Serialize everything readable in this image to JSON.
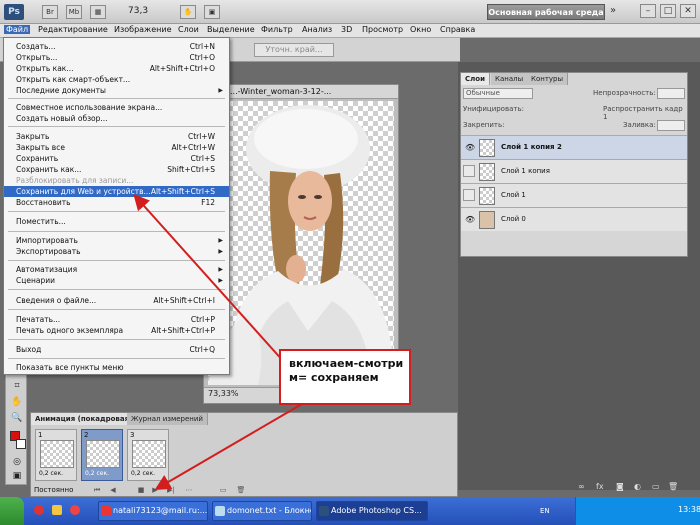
{
  "app": {
    "logo": "Ps",
    "zoom": "73,3",
    "workspace": "Основная рабочая среда",
    "more": "»"
  },
  "menubar": {
    "items": [
      "Файл",
      "Редактирование",
      "Изображение",
      "Слои",
      "Выделение",
      "Фильтр",
      "Анализ",
      "3D",
      "Просмотр",
      "Окно",
      "Справка"
    ]
  },
  "options": {
    "refine_edge": "Уточн. край..."
  },
  "file_menu": {
    "items": [
      {
        "label": "Создать...",
        "shortcut": "Ctrl+N"
      },
      {
        "label": "Открыть...",
        "shortcut": "Ctrl+O"
      },
      {
        "label": "Открыть как...",
        "shortcut": "Alt+Shift+Ctrl+O"
      },
      {
        "label": "Открыть как смарт-объект...",
        "shortcut": ""
      },
      {
        "label": "Последние документы",
        "shortcut": ""
      },
      {
        "label": "Совместное использование экрана...",
        "shortcut": ""
      },
      {
        "label": "Создать новый обзор...",
        "shortcut": ""
      },
      {
        "label": "Закрыть",
        "shortcut": "Ctrl+W"
      },
      {
        "label": "Закрыть все",
        "shortcut": "Alt+Ctrl+W"
      },
      {
        "label": "Сохранить",
        "shortcut": "Ctrl+S"
      },
      {
        "label": "Сохранить как...",
        "shortcut": "Shift+Ctrl+S"
      },
      {
        "label": "Разблокировать для записи...",
        "shortcut": ""
      },
      {
        "label": "Сохранить для Web и устройств...",
        "shortcut": "Alt+Shift+Ctrl+S"
      },
      {
        "label": "Восстановить",
        "shortcut": "F12"
      },
      {
        "label": "Поместить...",
        "shortcut": ""
      },
      {
        "label": "Импортировать",
        "shortcut": ""
      },
      {
        "label": "Экспортировать",
        "shortcut": ""
      },
      {
        "label": "Автоматизация",
        "shortcut": ""
      },
      {
        "label": "Сценарии",
        "shortcut": ""
      },
      {
        "label": "Сведения о файле...",
        "shortcut": "Alt+Shift+Ctrl+I"
      },
      {
        "label": "Печатать...",
        "shortcut": "Ctrl+P"
      },
      {
        "label": "Печать одного экземпляра",
        "shortcut": "Alt+Shift+Ctrl+P"
      },
      {
        "label": "Выход",
        "shortcut": "Ctrl+Q"
      },
      {
        "label": "Показать все пункты меню",
        "shortcut": ""
      }
    ]
  },
  "document": {
    "title": "...-Winter_woman-3-12-...",
    "zoom": "73,33%"
  },
  "layers_panel": {
    "tabs": [
      "Слои",
      "Каналы",
      "Контуры"
    ],
    "blend_mode": "Обычные",
    "opacity_label": "Непрозрачность:",
    "unify_label": "Унифицировать:",
    "propagate_label": "Распространить кадр 1",
    "lock_label": "Закрепить:",
    "fill_label": "Заливка:",
    "layers": [
      {
        "name": "Слой 1 копия 2",
        "visible": true,
        "selected": true
      },
      {
        "name": "Слой 1 копия",
        "visible": false,
        "selected": false
      },
      {
        "name": "Слой 1",
        "visible": false,
        "selected": false
      },
      {
        "name": "Слой 0",
        "visible": true,
        "selected": false
      }
    ]
  },
  "animation_panel": {
    "tabs": [
      "Анимация (покадровая)",
      "Журнал измерений"
    ],
    "frames": [
      {
        "num": "1",
        "delay": "0,2 сек."
      },
      {
        "num": "2",
        "delay": "0,2 сек."
      },
      {
        "num": "3",
        "delay": "0,2 сек."
      }
    ],
    "loop": "Постоянно"
  },
  "annotation": {
    "line1": "включаем-смотри",
    "line2": "м= сохраняем"
  },
  "taskbar": {
    "items": [
      {
        "label": "natali73123@mail.ru:..."
      },
      {
        "label": "domonet.txt - Блокнот"
      },
      {
        "label": "Adobe Photoshop CS..."
      }
    ],
    "lang": "EN",
    "clock": "13:38"
  },
  "colors": {
    "menu_highlight": "#3169c6",
    "annotation_red": "#d31e1e",
    "taskbar_blue": "#2450b8"
  }
}
